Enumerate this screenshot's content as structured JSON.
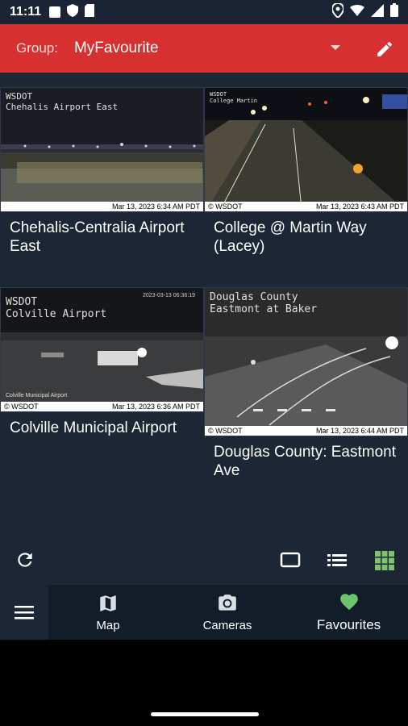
{
  "status_bar": {
    "time": "11:11"
  },
  "toolbar": {
    "group_label": "Group:",
    "group_value": "MyFavourite",
    "accent": "#d63031"
  },
  "cameras": [
    {
      "title": "Chehalis-Centralia Airport East",
      "caption": "WSDOT\nChehalis Airport East",
      "stamp_left": "",
      "stamp_right": "Mar 13, 2023 6:34 AM PDT"
    },
    {
      "title": "College @ Martin Way (Lacey)",
      "caption": "WSDOT\nCollege Martin",
      "stamp_left": "© WSDOT",
      "stamp_right": "Mar 13, 2023  6:43 AM PDT"
    },
    {
      "title": "Colville Municipal Airport",
      "caption": "WSDOT\nColville Airport",
      "stamp_left": "© WSDOT",
      "stamp_right": "Mar 13, 2023 6:36 AM PDT"
    },
    {
      "title": "Douglas County: Eastmont Ave",
      "caption": "Douglas County\nEastmont at Baker",
      "stamp_left": "© WSDOT",
      "stamp_right": "Mar 13, 2023  6:44 AM PDT"
    }
  ],
  "cam_overlay": {
    "colville_date": "2023-03-13 06:36:19",
    "colville_footer": "Colville Municipal Airport"
  },
  "view_modes": {
    "active": "grid",
    "active_color": "#7cc36b"
  },
  "bottom_nav": {
    "map_label": "Map",
    "cameras_label": "Cameras",
    "favourites_label": "Favourites",
    "active": "favourites",
    "favourite_color": "#6cc56c"
  }
}
